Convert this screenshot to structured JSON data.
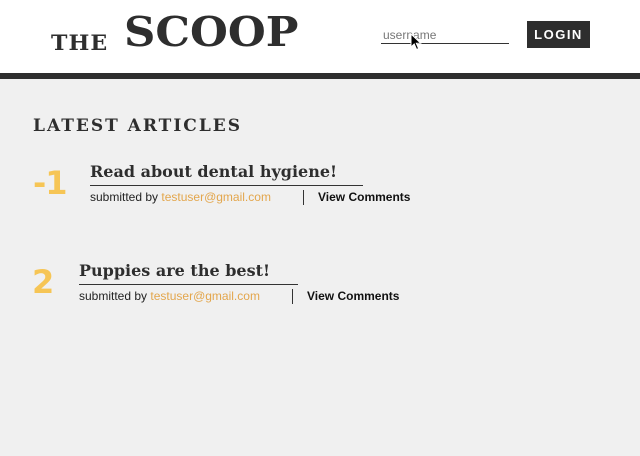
{
  "header": {
    "logo_the": "THE",
    "logo_scoop": "SCOOP",
    "username_placeholder": "username",
    "login_label": "LOGIN"
  },
  "main": {
    "section_title": "LATEST ARTICLES",
    "articles": [
      {
        "rank": "-1",
        "title": "Read about dental hygiene!",
        "submitted_by_label": "submitted by",
        "author": "testuser@gmail.com",
        "comments_label": "View Comments"
      },
      {
        "rank": "2",
        "title": "Puppies are the best!",
        "submitted_by_label": "submitted by",
        "author": "testuser@gmail.com",
        "comments_label": "View Comments"
      }
    ]
  },
  "colors": {
    "rank_accent": "#f6c555",
    "email_accent": "#e3a64c",
    "dark": "#2e2e2e",
    "background": "#f0f0f0"
  },
  "icons": {
    "cursor": "mouse-pointer-icon"
  }
}
